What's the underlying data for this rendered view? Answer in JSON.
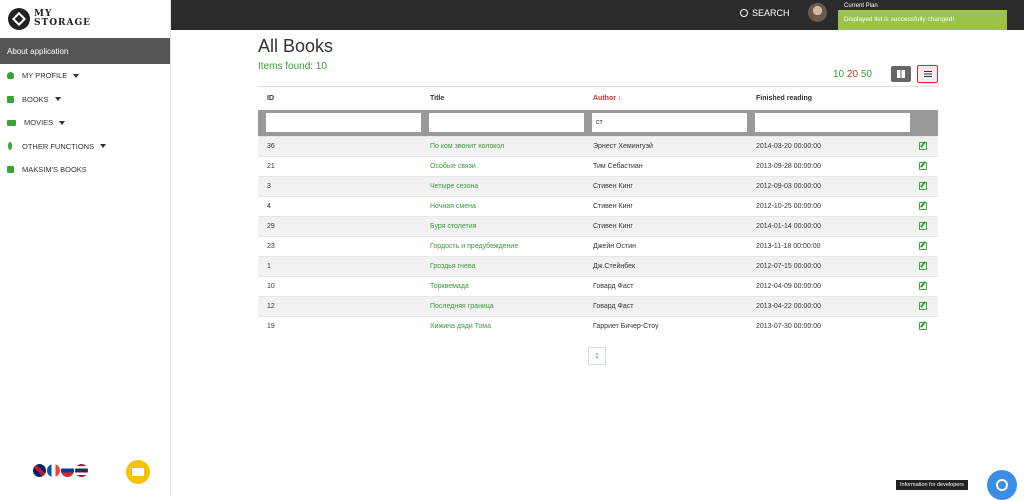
{
  "logo": {
    "line1": "MY",
    "line2": "STORAGE"
  },
  "sidebar": {
    "about": "About application",
    "items": [
      {
        "label": "MY PROFILE",
        "icon": "user-icon",
        "has_caret": true
      },
      {
        "label": "BOOKS",
        "icon": "book-icon",
        "has_caret": true
      },
      {
        "label": "MOVIES",
        "icon": "camera-icon",
        "has_caret": true
      },
      {
        "label": "OTHER FUNCTIONS",
        "icon": "leaf-icon",
        "has_caret": true
      },
      {
        "label": "MAKSIM'S BOOKS",
        "icon": "book-icon",
        "has_caret": false
      }
    ],
    "languages": [
      "uk-flag-icon",
      "fr-flag-icon",
      "ru-flag-icon",
      "th-flag-icon"
    ]
  },
  "topbar": {
    "search_label": "SEARCH",
    "plan_label": "Current Plan",
    "toast": "Displayed list is successfully changed!"
  },
  "main": {
    "title": "All Books",
    "items_found": "Items found: 10",
    "page_sizes": [
      "10",
      "20",
      "50"
    ],
    "table": {
      "headers": [
        "ID",
        "Title",
        "Author ↓",
        "Finished reading"
      ],
      "filters": [
        "",
        "",
        "ст",
        ""
      ],
      "rows": [
        [
          "36",
          "По ком звонит колокол",
          "Эрнест Хемингуэй",
          "2014-03-20 00:00:00"
        ],
        [
          "21",
          "Особые связи",
          "Тим Себастиан",
          "2013-09-28 00:00:00"
        ],
        [
          "3",
          "Четыре сезона",
          "Стивен Кинг",
          "2012-09-03 00:00:00"
        ],
        [
          "4",
          "Ночная смена",
          "Стивен Кинг",
          "2012-10-25 00:00:00"
        ],
        [
          "29",
          "Буря столетия",
          "Стивен Кинг",
          "2014-01-14 00:00:00"
        ],
        [
          "23",
          "Гордость и  предубеждение",
          "Джейн Остин",
          "2013-11-18 00:00:00"
        ],
        [
          "1",
          "Гроздья гнева",
          "Дж.Стейнбек",
          "2012-07-15 00:00:00"
        ],
        [
          "10",
          "Торквемада",
          "Говард Фаст",
          "2012-04-09 00:00:00"
        ],
        [
          "12",
          "Последняя граница",
          "Говард Фаст",
          "2013-04-22 00:00:00"
        ],
        [
          "19",
          "Хижина дяди Тома",
          "Гарриет Бичер-Стоу",
          "2013-07-30 00:00:00"
        ]
      ]
    },
    "pagination": [
      "1"
    ]
  },
  "developers_tip": "Information for developers"
}
